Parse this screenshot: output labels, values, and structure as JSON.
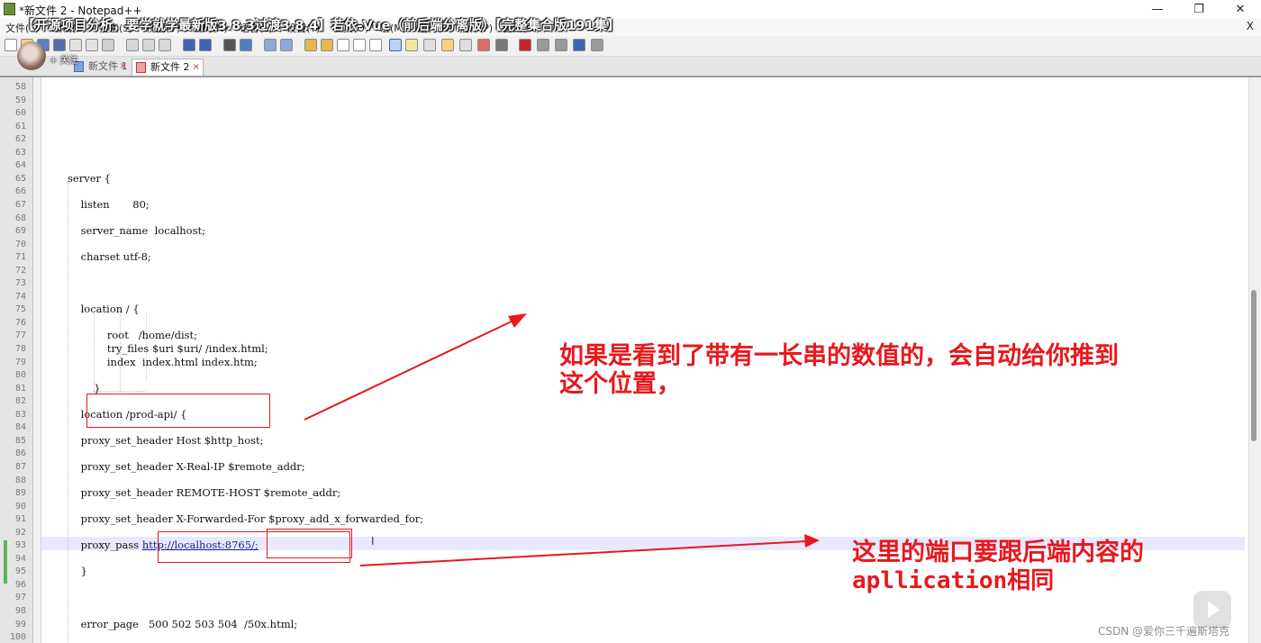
{
  "window": {
    "title": "*新文件 2 - Notepad++",
    "buttons": {
      "minimize": "—",
      "maximize": "❐",
      "close": "✕"
    }
  },
  "menu": {
    "items": [
      "文件(F)",
      "编辑(E)",
      "搜索(S)",
      "视图(V)",
      "编码(N)",
      "语言(L)",
      "设置(T)",
      "工具(O)",
      "宏(M)",
      "运行(R)",
      "插件(P)",
      "窗口(W)",
      "?"
    ],
    "close_label": "X"
  },
  "video_overlay": {
    "title": "【开源项目分析，要学就学最新版3.8.3过渡3.8.4】若依-Vue（前后端分离版）【完整集合版191集】",
    "follow_label": "+ 关注"
  },
  "tabs": [
    {
      "label": "新文件 1",
      "active": false
    },
    {
      "label": "新文件 2",
      "active": true
    }
  ],
  "editor": {
    "lines": [
      {
        "n": "58",
        "text": ""
      },
      {
        "n": "59",
        "text": ""
      },
      {
        "n": "60",
        "text": ""
      },
      {
        "n": "61",
        "text": ""
      },
      {
        "n": "62",
        "text": ""
      },
      {
        "n": "63",
        "text": ""
      },
      {
        "n": "64",
        "text": ""
      },
      {
        "n": "65",
        "text": "server {"
      },
      {
        "n": "66",
        "text": ""
      },
      {
        "n": "67",
        "text": "    listen       80;"
      },
      {
        "n": "68",
        "text": ""
      },
      {
        "n": "69",
        "text": "    server_name  localhost;"
      },
      {
        "n": "70",
        "text": ""
      },
      {
        "n": "71",
        "text": "    charset utf-8;"
      },
      {
        "n": "72",
        "text": ""
      },
      {
        "n": "73",
        "text": ""
      },
      {
        "n": "74",
        "text": ""
      },
      {
        "n": "75",
        "text": "    location / {"
      },
      {
        "n": "76",
        "text": ""
      },
      {
        "n": "77",
        "text": "            root   /home/dist;"
      },
      {
        "n": "78",
        "text": "            try_files $uri $uri/ /index.html;"
      },
      {
        "n": "79",
        "text": "            index  index.html index.htm;"
      },
      {
        "n": "80",
        "text": ""
      },
      {
        "n": "81",
        "text": "        }"
      },
      {
        "n": "82",
        "text": ""
      },
      {
        "n": "83",
        "text": "    location /prod-api/ {"
      },
      {
        "n": "84",
        "text": ""
      },
      {
        "n": "85",
        "text": "    proxy_set_header Host $http_host;"
      },
      {
        "n": "86",
        "text": ""
      },
      {
        "n": "87",
        "text": "    proxy_set_header X-Real-IP $remote_addr;"
      },
      {
        "n": "88",
        "text": ""
      },
      {
        "n": "89",
        "text": "    proxy_set_header REMOTE-HOST $remote_addr;"
      },
      {
        "n": "90",
        "text": ""
      },
      {
        "n": "91",
        "text": "    proxy_set_header X-Forwarded-For $proxy_add_x_forwarded_for;"
      },
      {
        "n": "92",
        "text": ""
      },
      {
        "n": "93",
        "text": "    proxy_pass ",
        "link": "http://localhost:8765/;"
      },
      {
        "n": "94",
        "text": ""
      },
      {
        "n": "95",
        "text": "    }"
      },
      {
        "n": "96",
        "text": ""
      },
      {
        "n": "97",
        "text": ""
      },
      {
        "n": "98",
        "text": ""
      },
      {
        "n": "99",
        "text": "    error_page   500 502 503 504  /50x.html;"
      },
      {
        "n": "100",
        "text": ""
      }
    ]
  },
  "annotations": {
    "note1_line1": "如果是看到了带有一长串的数值的，会自动给你推到",
    "note1_line2": "这个位置，",
    "note2_line1": "这里的端口要跟后端内容的",
    "note2_line2": "apllication相同",
    "color": "#e8181c"
  },
  "watermark": "CSDN @爱你三千遍斯塔克"
}
